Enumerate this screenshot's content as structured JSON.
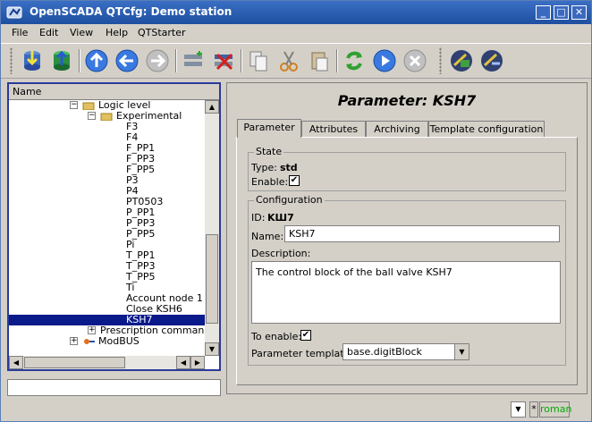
{
  "window": {
    "title": "OpenSCADA QTCfg: Demo station",
    "min": "_",
    "max": "□",
    "close": "✕"
  },
  "menu": [
    "File",
    "Edit",
    "View",
    "Help",
    "QTStarter"
  ],
  "tree": {
    "header": "Name",
    "rows": [
      {
        "label": "Logic level",
        "indent": 0,
        "exp": "−",
        "icon": "folder-icon"
      },
      {
        "label": "Experimental",
        "indent": 1,
        "exp": "−",
        "icon": "folder-icon"
      },
      {
        "label": "F3",
        "indent": 2
      },
      {
        "label": "F4",
        "indent": 2
      },
      {
        "label": "F_PP1",
        "indent": 2
      },
      {
        "label": "F_PP3",
        "indent": 2
      },
      {
        "label": "F_PP5",
        "indent": 2
      },
      {
        "label": "P3",
        "indent": 2
      },
      {
        "label": "P4",
        "indent": 2
      },
      {
        "label": "PT0503",
        "indent": 2
      },
      {
        "label": "P_PP1",
        "indent": 2
      },
      {
        "label": "P_PP3",
        "indent": 2
      },
      {
        "label": "P_PP5",
        "indent": 2
      },
      {
        "label": "Pi",
        "indent": 2
      },
      {
        "label": "T_PP1",
        "indent": 2
      },
      {
        "label": "T_PP3",
        "indent": 2
      },
      {
        "label": "T_PP5",
        "indent": 2
      },
      {
        "label": "Ti",
        "indent": 2
      },
      {
        "label": "Account node 1",
        "indent": 2
      },
      {
        "label": "Close KSH6",
        "indent": 2
      },
      {
        "label": "KSH7",
        "indent": 2,
        "selected": true
      },
      {
        "label": "Prescription commands",
        "indent": 1,
        "exp": "+"
      },
      {
        "label": "ModBUS",
        "indent": 0,
        "exp": "+",
        "icon": "modbus-icon"
      }
    ]
  },
  "panel": {
    "title": "Parameter: KSH7",
    "tabs": [
      "Parameter",
      "Attributes",
      "Archiving",
      "Template configuration"
    ],
    "state": {
      "group": "State",
      "type_label": "Type:",
      "type_value": "std",
      "enable_label": "Enable:"
    },
    "config": {
      "group": "Configuration",
      "id_label": "ID:",
      "id_value": "KШ7",
      "name_label": "Name:",
      "name_value": "KSH7",
      "desc_label": "Description:",
      "desc_value": "The control block of the ball valve KSH7",
      "toenable_label": "To enable:",
      "template_label": "Parameter template:",
      "template_value": "base.digitBlock"
    }
  },
  "status": {
    "lang": "roman",
    "star": "*"
  }
}
